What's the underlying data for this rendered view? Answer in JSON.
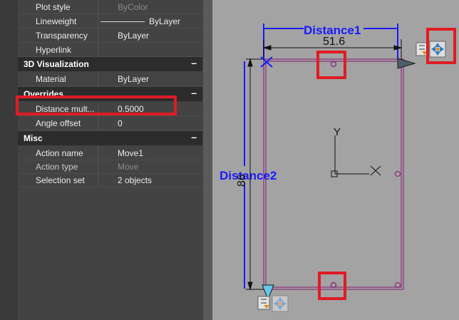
{
  "properties": {
    "general_rows": [
      {
        "label": "Plot style",
        "value": "ByColor",
        "disabled": true
      },
      {
        "label": "Lineweight",
        "value": "ByLayer",
        "disabled": false
      },
      {
        "label": "Transparency",
        "value": "ByLayer",
        "disabled": false
      },
      {
        "label": "Hyperlink",
        "value": "",
        "disabled": false
      }
    ],
    "viz_header": "3D Visualization",
    "viz_rows": [
      {
        "label": "Material",
        "value": "ByLayer"
      }
    ],
    "overrides_header": "Overrides",
    "overrides_rows": [
      {
        "label": "Distance  mult...",
        "value": "0.5000"
      },
      {
        "label": "Angle offset",
        "value": "0"
      }
    ],
    "misc_header": "Misc",
    "misc_rows": [
      {
        "label": "Action name",
        "value": "Move1",
        "disabled": false
      },
      {
        "label": "Action type",
        "value": "Move",
        "disabled": true
      },
      {
        "label": "Selection set",
        "value": "2 objects",
        "disabled": false
      }
    ],
    "collapse_symbol": "–"
  },
  "drawing": {
    "param_distance1": "Distance1",
    "param_distance2": "Distance2",
    "dim_horizontal": "51.6",
    "dim_vertical": "86",
    "ucs_x": "X",
    "ucs_y": "Y",
    "colors": {
      "parameter_blue": "#1a1aff",
      "shape_magenta": "#8b2f7a",
      "highlight_red": "#e01b24",
      "canvas_gray": "#a3a3a3"
    }
  }
}
